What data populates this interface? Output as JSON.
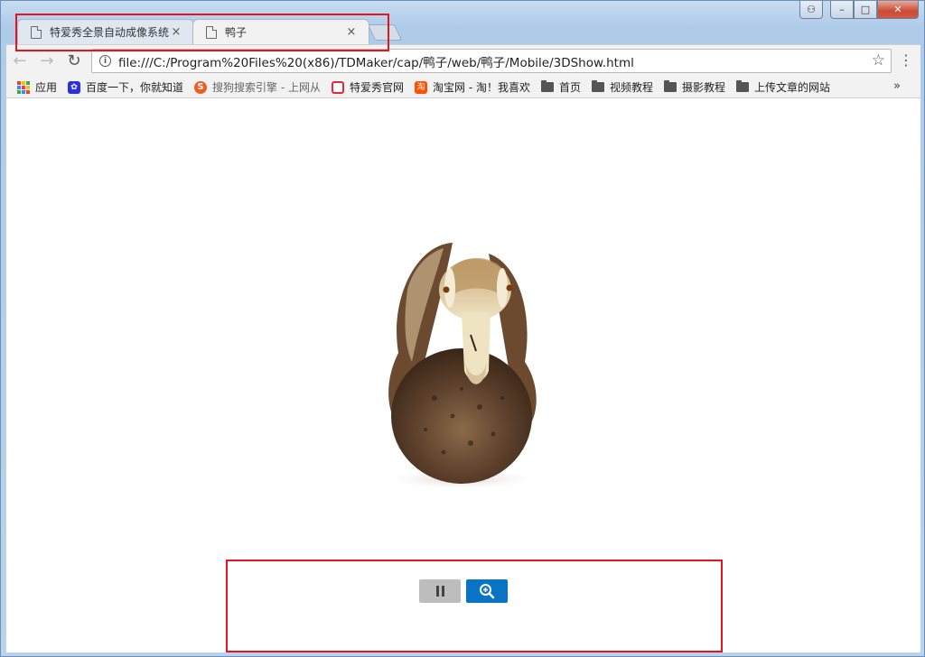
{
  "browser": {
    "tabs": [
      {
        "title": "特爱秀全景自动成像系统",
        "close": "×"
      },
      {
        "title": "鸭子",
        "close": "×"
      }
    ],
    "address": {
      "url": "file:///C:/Program%20Files%20(x86)/TDMaker/cap/鸭子/web/鸭子/Mobile/3DShow.html"
    },
    "nav": {
      "back": "←",
      "forward": "→",
      "reload": "↻",
      "star": "☆",
      "menu": "⋮"
    },
    "caption": {
      "minimize": "–",
      "maximize": "□",
      "close": "✕"
    },
    "bookmarks": [
      {
        "label": "应用",
        "icon": "apps-icon"
      },
      {
        "label": "百度一下，你就知道",
        "icon": "baidu-icon"
      },
      {
        "label": "搜狗搜索引擎 - 上网从",
        "icon": "sogou-icon"
      },
      {
        "label": "特爱秀官网",
        "icon": "camera-icon"
      },
      {
        "label": "淘宝网 - 淘！我喜欢",
        "icon": "taobao-icon"
      },
      {
        "label": "首页",
        "icon": "folder-icon"
      },
      {
        "label": "视频教程",
        "icon": "folder-icon"
      },
      {
        "label": "摄影教程",
        "icon": "folder-icon"
      },
      {
        "label": "上传文章的网站",
        "icon": "folder-icon"
      }
    ],
    "bookmarks_more": "»"
  },
  "viewer": {
    "image": "duck figurine (3D product view)",
    "buttons": [
      {
        "name": "pause",
        "icon": "pause-icon",
        "color": "#bdbdbd"
      },
      {
        "name": "zoom-in",
        "icon": "zoom-in-icon",
        "color": "#0a74c4"
      }
    ]
  },
  "colors": {
    "highlight": "#e8141b",
    "accent": "#0a74c4"
  }
}
